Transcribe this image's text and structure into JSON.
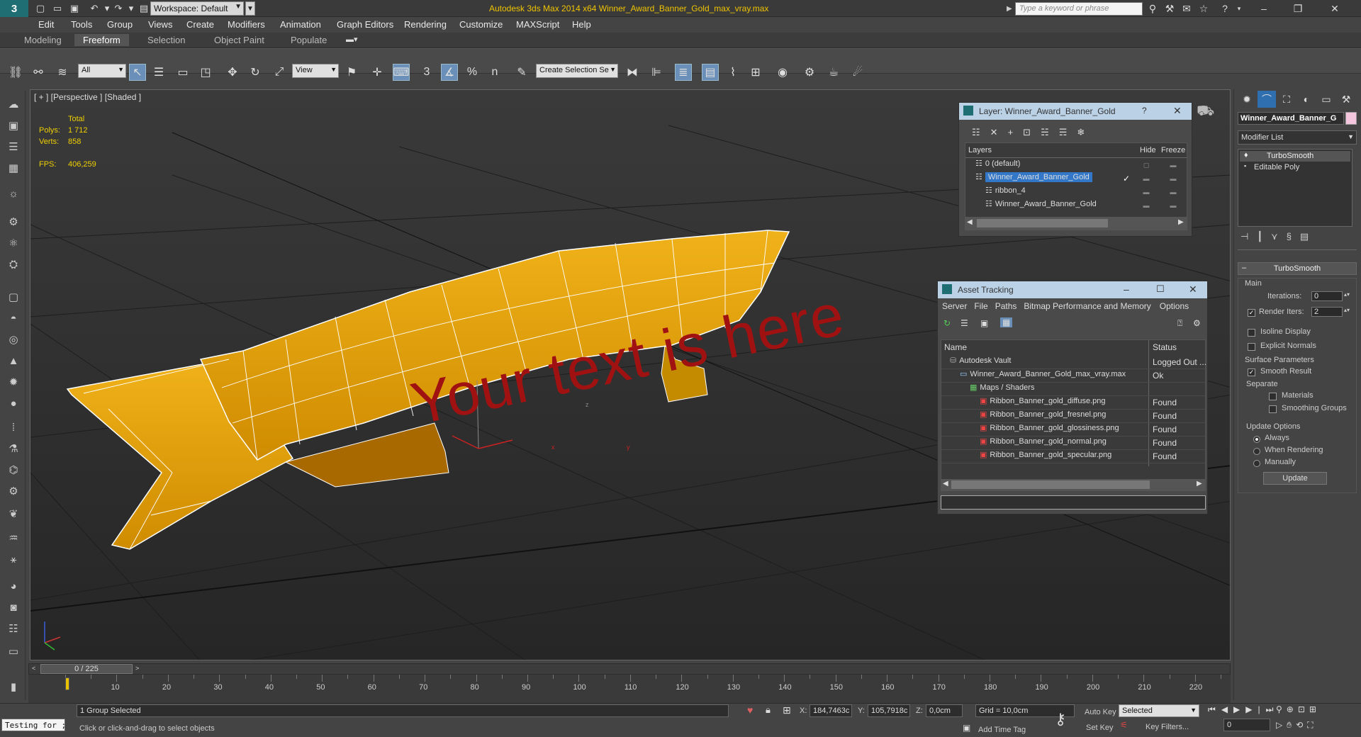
{
  "app": {
    "logo_label": "3",
    "title": "Autodesk 3ds Max  2014 x64     Winner_Award_Banner_Gold_max_vray.max",
    "workspace_label": "Workspace: Default",
    "search_placeholder": "Type a keyword or phrase"
  },
  "menu": [
    "Edit",
    "Tools",
    "Group",
    "Views",
    "Create",
    "Modifiers",
    "Animation",
    "Graph Editors",
    "Rendering",
    "Customize",
    "MAXScript",
    "Help"
  ],
  "ribbon_tabs": [
    "Modeling",
    "Freeform",
    "Selection",
    "Object Paint",
    "Populate"
  ],
  "ribbon_active": "Freeform",
  "toolbar": {
    "filter_value": "All",
    "refcoord_value": "View",
    "named_selection_value": "Create Selection Se",
    "snap_3": "3",
    "snap_pct": "%",
    "snap_n": "n"
  },
  "viewport": {
    "label": "[ + ] [Perspective ] [Shaded ]",
    "stats_header": "Total",
    "polys_label": "Polys:",
    "polys_value": "1 712",
    "verts_label": "Verts:",
    "verts_value": "858",
    "fps_label": "FPS:",
    "fps_value": "406,259",
    "banner_text": "Your text is here",
    "axis_x": "x",
    "axis_y": "y",
    "axis_z": "z"
  },
  "layer_dialog": {
    "title": "Layer: Winner_Award_Banner_Gold",
    "help": "?",
    "close": "✕",
    "col_layers": "Layers",
    "col_hide": "Hide",
    "col_freeze": "Freeze",
    "rows": [
      {
        "name": "0 (default)",
        "indent": 1,
        "selected": false
      },
      {
        "name": "Winner_Award_Banner_Gold",
        "indent": 1,
        "selected": true
      },
      {
        "name": "ribbon_4",
        "indent": 2,
        "selected": false
      },
      {
        "name": "Winner_Award_Banner_Gold",
        "indent": 2,
        "selected": false
      }
    ]
  },
  "asset_tracking": {
    "title": "Asset Tracking",
    "menu": [
      "Server",
      "File",
      "Paths",
      "Bitmap Performance and Memory",
      "Options"
    ],
    "col_name": "Name",
    "col_status": "Status",
    "rows": [
      {
        "name": "Autodesk Vault",
        "status": "Logged Out ...",
        "indent": 1,
        "icon": "vault"
      },
      {
        "name": "Winner_Award_Banner_Gold_max_vray.max",
        "status": "Ok",
        "indent": 2,
        "icon": "file"
      },
      {
        "name": "Maps / Shaders",
        "status": "",
        "indent": 3,
        "icon": "maps"
      },
      {
        "name": "Ribbon_Banner_gold_diffuse.png",
        "status": "Found",
        "indent": 4,
        "icon": "png"
      },
      {
        "name": "Ribbon_Banner_gold_fresnel.png",
        "status": "Found",
        "indent": 4,
        "icon": "png"
      },
      {
        "name": "Ribbon_Banner_gold_glossiness.png",
        "status": "Found",
        "indent": 4,
        "icon": "png"
      },
      {
        "name": "Ribbon_Banner_gold_normal.png",
        "status": "Found",
        "indent": 4,
        "icon": "png"
      },
      {
        "name": "Ribbon_Banner_gold_specular.png",
        "status": "Found",
        "indent": 4,
        "icon": "png"
      }
    ]
  },
  "command_panel": {
    "object_name": "Winner_Award_Banner_G",
    "modifier_list": "Modifier List",
    "stack": [
      "TurboSmooth",
      "Editable Poly"
    ],
    "rollout_title": "TurboSmooth",
    "main_label": "Main",
    "iterations_label": "Iterations:",
    "iterations_value": "0",
    "render_iters_label": "Render Iters:",
    "render_iters_value": "2",
    "isoline_label": "Isoline Display",
    "explicit_normals_label": "Explicit Normals",
    "surface_params_label": "Surface Parameters",
    "smooth_result_label": "Smooth Result",
    "separate_label": "Separate",
    "materials_label": "Materials",
    "smoothing_groups_label": "Smoothing Groups",
    "update_options_label": "Update Options",
    "always_label": "Always",
    "when_rendering_label": "When Rendering",
    "manually_label": "Manually",
    "update_button": "Update"
  },
  "timeline": {
    "frame_display": "0 / 225",
    "ticks": [
      10,
      20,
      30,
      40,
      50,
      60,
      70,
      80,
      90,
      100,
      110,
      120,
      130,
      140,
      150,
      160,
      170,
      180,
      190,
      200,
      210,
      220
    ],
    "max_frame": 225
  },
  "status": {
    "maxscript_value": "Testing for ;",
    "selection_info": "1 Group Selected",
    "prompt": "Click or click-and-drag to select objects",
    "x_label": "X:",
    "x_value": "184,7463c",
    "y_label": "Y:",
    "y_value": "105,7918c",
    "z_label": "Z:",
    "z_value": "0,0cm",
    "grid": "Grid = 10,0cm",
    "add_time_tag": "Add Time Tag",
    "auto_key": "Auto Key",
    "set_key": "Set Key",
    "selected_value": "Selected",
    "key_filters": "Key Filters...",
    "frame_value": "0"
  }
}
